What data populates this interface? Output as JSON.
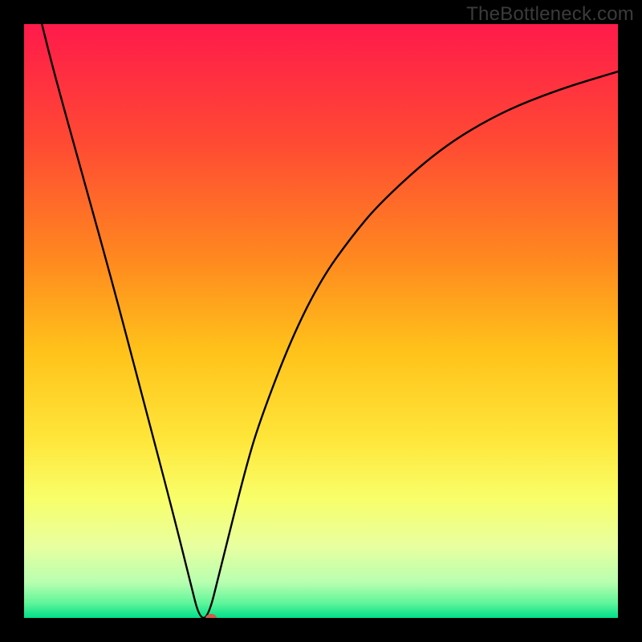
{
  "watermark": "TheBottleneck.com",
  "chart_data": {
    "type": "line",
    "title": "",
    "xlabel": "",
    "ylabel": "",
    "xlim": [
      0,
      100
    ],
    "ylim": [
      0,
      100
    ],
    "series": [
      {
        "name": "curve",
        "x": [
          3,
          5,
          10,
          15,
          20,
          25,
          28,
          29.5,
          31,
          33,
          37.5,
          40,
          45,
          50,
          55,
          60,
          70,
          80,
          90,
          100
        ],
        "y": [
          100,
          92,
          74,
          56,
          37,
          18,
          6,
          0,
          0,
          8,
          26,
          34,
          47,
          57,
          64,
          70,
          79,
          85,
          89,
          92
        ]
      }
    ],
    "marker": {
      "x": 31.5,
      "y": 0,
      "color": "#d05a4a",
      "rx": 7,
      "ry": 5
    },
    "background_gradient": {
      "stops": [
        {
          "offset": 0.0,
          "color": "#ff1a4b"
        },
        {
          "offset": 0.2,
          "color": "#ff4a33"
        },
        {
          "offset": 0.4,
          "color": "#ff8a1f"
        },
        {
          "offset": 0.55,
          "color": "#ffc21a"
        },
        {
          "offset": 0.7,
          "color": "#ffe63a"
        },
        {
          "offset": 0.8,
          "color": "#f8ff6a"
        },
        {
          "offset": 0.88,
          "color": "#e8ffa0"
        },
        {
          "offset": 0.94,
          "color": "#b8ffb0"
        },
        {
          "offset": 0.975,
          "color": "#60f59a"
        },
        {
          "offset": 1.0,
          "color": "#00e08a"
        }
      ]
    }
  }
}
